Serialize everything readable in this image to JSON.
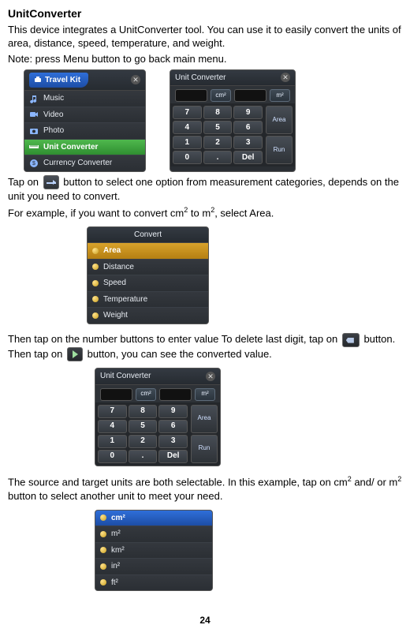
{
  "title": "UnitConverter",
  "intro": "This device integrates a UnitConverter tool. You can use it to easily convert the units of area, distance, speed, temperature, and weight.",
  "note": "Note: press Menu button to go back main menu.",
  "pageNumber": "24",
  "travelKit": {
    "title": "Travel Kit",
    "items": [
      "Music",
      "Video",
      "Photo",
      "Unit Converter",
      "Currency Converter"
    ]
  },
  "convertMenu": {
    "title": "Convert",
    "items": [
      "Area",
      "Distance",
      "Speed",
      "Temperature",
      "Weight"
    ]
  },
  "unitMenu": {
    "title": "",
    "items": [
      "cm²",
      "m²",
      "km²",
      "in²",
      "ft²"
    ]
  },
  "converter": {
    "title": "Unit Converter",
    "unitLeftLabel": "cm²",
    "unitRightLabel": "m²",
    "keys": [
      "7",
      "8",
      "9",
      "4",
      "5",
      "6",
      "1",
      "2",
      "3",
      "0",
      ".",
      "Del"
    ],
    "sideTop": "Area",
    "sideBottom": "Run"
  },
  "p2_before": "Tap on ",
  "p2_after": "button to select one option from measurement categories, depends on the unit you need to convert.",
  "p3_a": "For example, if you want to convert cm",
  "p3_b": " to m",
  "p3_c": ", select Area.",
  "p4_a": "Then tap on the number buttons to enter value To delete last digit, tap on ",
  "p4_b": " button. Then tap on ",
  "p4_c": " button, you can see the converted value.",
  "p5_a": "The source and target units are both selectable. In this example, tap on cm",
  "p5_b": " and/ or m",
  "p5_c": " button to select another unit to meet your need."
}
